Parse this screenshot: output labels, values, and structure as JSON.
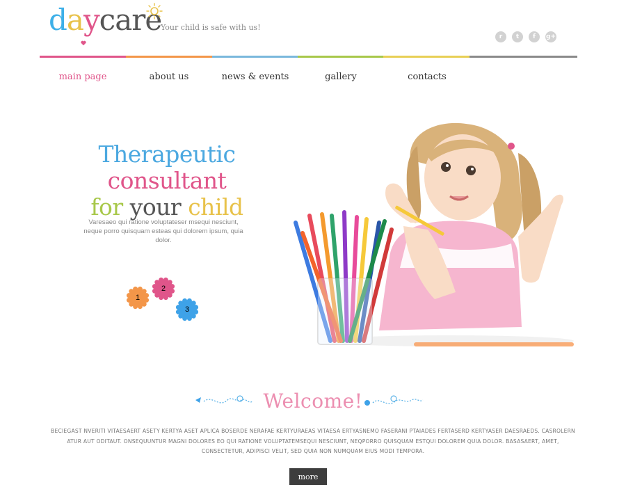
{
  "logo": {
    "letters": [
      "d",
      "a",
      "y",
      "c",
      "a",
      "r",
      "e"
    ],
    "colors": [
      "#3eb0e8",
      "#e8c24a",
      "#e0558a",
      "#555555",
      "#555555",
      "#555555",
      "#555555"
    ],
    "tagline": "Your child is safe with us!"
  },
  "social": [
    {
      "icon": "rss-icon",
      "glyph": "r"
    },
    {
      "icon": "twitter-icon",
      "glyph": "t"
    },
    {
      "icon": "facebook-icon",
      "glyph": "f"
    },
    {
      "icon": "google-plus-icon",
      "glyph": "g+"
    }
  ],
  "nav": {
    "bar_colors": [
      "#e0558a",
      "#f39649",
      "#7ab8dc",
      "#a8c84a",
      "#e8cf55",
      "#8a8a8a"
    ],
    "items": [
      {
        "label": "main page",
        "active": true
      },
      {
        "label": "about us"
      },
      {
        "label": "news & events"
      },
      {
        "label": "gallery"
      },
      {
        "label": "contacts"
      }
    ]
  },
  "hero": {
    "title_line1": [
      {
        "text": "Therapeutic ",
        "color": "#4ba8e0"
      },
      {
        "text": "consultant",
        "color": "#e0558a"
      }
    ],
    "title_line2": [
      {
        "text": "for ",
        "color": "#a8c84a"
      },
      {
        "text": "your ",
        "color": "#555555"
      },
      {
        "text": "child",
        "color": "#e8c24a"
      }
    ],
    "text": "Varesaeo qui ratione voluptateser msequi nesciunt, neque porro quisquam esteas qui dolorem ipsum, quia dolor.",
    "flowers": [
      {
        "num": "1",
        "color": "#f39649"
      },
      {
        "num": "2",
        "color": "#e0558a"
      },
      {
        "num": "3",
        "color": "#3ea2e8"
      }
    ]
  },
  "welcome": {
    "title": "Welcome!",
    "text": "Beciegast nveriti vitaesaert asety kertya aset aplica boserde nerafae kertyuraeas vitaesa ertyasnemo faserani ptaiades fertaserd kertyaser daesraeds. Casrolern atur aut oditaut. Onsequuntur magni dolores eo qui ratione voluptatemsequi nesciunt, neqporro quisquam estqui dolorem quia dolor. Basasaert, amet, consectetur, adipisci velit, sed quia non numquam eius modi tempora.",
    "button": "more"
  }
}
